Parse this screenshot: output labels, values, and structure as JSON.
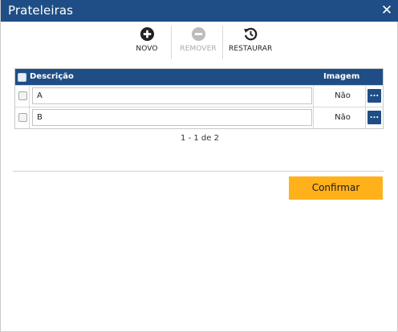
{
  "dialog": {
    "title": "Prateleiras",
    "close_icon": "close-icon"
  },
  "toolbar": {
    "new_label": "NOVO",
    "remove_label": "REMOVER",
    "restore_label": "RESTAURAR"
  },
  "grid": {
    "columns": [
      "Descrição",
      "Imagem"
    ],
    "rows": [
      {
        "description": "A",
        "image": "Não",
        "action": "..."
      },
      {
        "description": "B",
        "image": "Não",
        "action": "..."
      }
    ]
  },
  "pager": {
    "text": "1 - 1 de 2"
  },
  "footer": {
    "confirm_label": "Confirmar"
  },
  "colors": {
    "header_blue": "#1f4e86",
    "confirm_orange": "#ffb11b"
  }
}
